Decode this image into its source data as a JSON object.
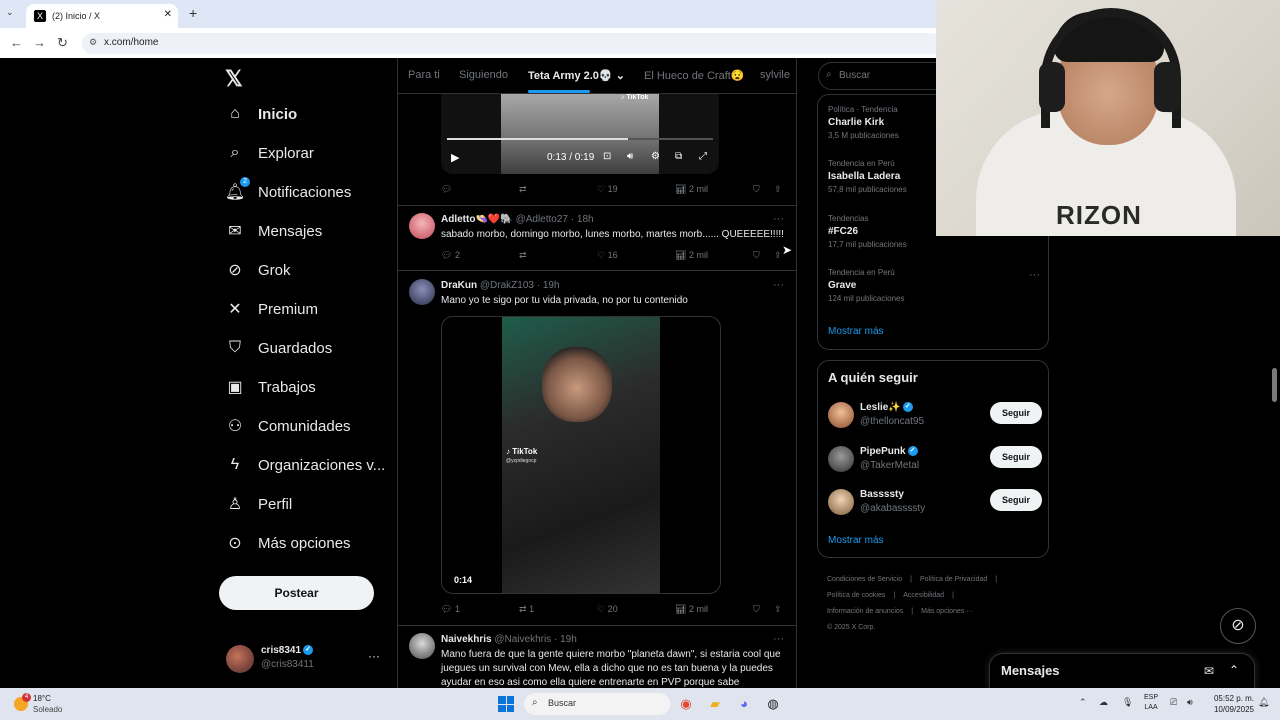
{
  "browser": {
    "tab_title": "(2) Inicio / X",
    "tab_favicon": "X",
    "tab_close": "✕",
    "new_tab": "+",
    "url": "x.com/home"
  },
  "sidebar": {
    "logo": "𝕏",
    "items": [
      {
        "label": "Inicio",
        "icon": "home-icon"
      },
      {
        "label": "Explorar",
        "icon": "search-icon"
      },
      {
        "label": "Notificaciones",
        "icon": "bell-icon",
        "badge": "2"
      },
      {
        "label": "Mensajes",
        "icon": "envelope-icon"
      },
      {
        "label": "Grok",
        "icon": "grok-icon"
      },
      {
        "label": "Premium",
        "icon": "x-icon"
      },
      {
        "label": "Guardados",
        "icon": "bookmark-icon"
      },
      {
        "label": "Trabajos",
        "icon": "briefcase-icon"
      },
      {
        "label": "Comunidades",
        "icon": "people-icon"
      },
      {
        "label": "Organizaciones v...",
        "icon": "lightning-icon"
      },
      {
        "label": "Perfil",
        "icon": "person-icon"
      },
      {
        "label": "Más opciones",
        "icon": "more-circle-icon"
      }
    ],
    "post_button": "Postear",
    "account": {
      "name": "cris8341",
      "handle": "@cris83411",
      "more": "···"
    }
  },
  "feed": {
    "tabs": [
      "Para ti",
      "Siguiendo",
      "Teta Army 2.0💀",
      "El Hueco de Craft😧",
      "sylvile"
    ],
    "active_tab": "Teta Army 2.0💀",
    "video1": {
      "tiktok": "♪ TikTok",
      "time": "0:13 / 0:19",
      "progress": 0.68,
      "actions": {
        "reply": "",
        "repost": "",
        "like": "19",
        "views": "2 mil"
      }
    },
    "tweets": [
      {
        "name": "Adletto👒❤️🐘",
        "handle": "@Adletto27",
        "time": "· 18h",
        "text": "sabado morbo, domingo morbo, lunes morbo, martes morb...... QUEEEEE!!!!!",
        "actions": {
          "reply": "2",
          "repost": "",
          "like": "16",
          "views": "2 mil"
        }
      },
      {
        "name": "DraKun",
        "handle": "@DrakZ103",
        "time": "· 19h",
        "text": "Mano yo te sigo por tu vida privada, no por tu contenido",
        "video": {
          "tiktok": "♪ TikTok",
          "tiktok_handle": "@yzpdiegocp",
          "duration": "0:14"
        },
        "actions": {
          "reply": "1",
          "repost": "1",
          "like": "20",
          "views": "2 mil"
        }
      },
      {
        "name": "Naivekhris",
        "handle": "@Naivekhris",
        "time": "· 19h",
        "text": "Mano fuera de que la gente quiere morbo \"planeta dawn\", si estaria cool que juegues un survival con Mew, ella a dicho que no es tan buena y la puedes ayudar en eso asi como ella quiere entrenarte en PVP porque sabe"
      }
    ]
  },
  "right": {
    "search_placeholder": "Buscar",
    "trends": [
      {
        "category": "Política · Tendencia",
        "name": "Charlie Kirk",
        "count": "3,5 M publicaciones"
      },
      {
        "category": "Tendencia en Perú",
        "name": "Isabella Ladera",
        "count": "57,8 mil publicaciones"
      },
      {
        "category": "Tendencias",
        "name": "#FC26",
        "count": "17,7 mil publicaciones"
      },
      {
        "category": "Tendencia en Perú",
        "name": "Grave",
        "count": "124 mil publicaciones"
      }
    ],
    "trends_more": "Mostrar más",
    "who_to_follow": {
      "title": "A quién seguir",
      "users": [
        {
          "name": "Leslie✨",
          "handle": "@thelloncat95",
          "button": "Seguir"
        },
        {
          "name": "PipePunk",
          "handle": "@TakerMetal",
          "button": "Seguir"
        },
        {
          "name": "Bassssty",
          "handle": "@akabassssty",
          "button": "Seguir"
        }
      ],
      "more": "Mostrar más"
    },
    "footer": {
      "line1": [
        "Condiciones de Servicio",
        "|",
        "Política de Privacidad",
        "|"
      ],
      "line2": [
        "Política de cookies",
        "|",
        "Accesibilidad",
        "|"
      ],
      "line3": [
        "Información de anuncios",
        "|",
        "Más opciones ···"
      ],
      "copyright": "© 2025 X Corp."
    }
  },
  "messages_dock": {
    "title": "Mensajes"
  },
  "webcam": {
    "shirt_text": "RIZON"
  },
  "taskbar": {
    "weather": {
      "temp": "18°C",
      "condition": "Soleado",
      "alert": "4"
    },
    "search": "Buscar",
    "lang": {
      "top": "ESP",
      "bottom": "LAA"
    },
    "time": "05:52 p. m.",
    "date": "10/09/2025"
  },
  "colors": {
    "accent": "#1d9bf0",
    "bg": "#000000",
    "border": "#2f3336",
    "muted": "#71767b"
  }
}
